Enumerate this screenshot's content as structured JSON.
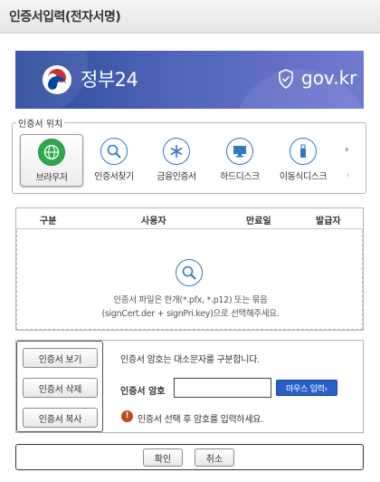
{
  "window": {
    "title": "인증서입력(전자서명)"
  },
  "banner": {
    "brand": "정부24",
    "domain": "gov.kr"
  },
  "location": {
    "legend": "인증서 위치",
    "items": [
      {
        "label": "브라우저",
        "icon": "globe-icon",
        "selected": true
      },
      {
        "label": "인증서찾기",
        "icon": "search-icon",
        "selected": false
      },
      {
        "label": "금융인증서",
        "icon": "asterisk-icon",
        "selected": false
      },
      {
        "label": "하드디스크",
        "icon": "monitor-icon",
        "selected": false
      },
      {
        "label": "이동식디스크",
        "icon": "usb-icon",
        "selected": false
      }
    ],
    "next": "›",
    "prev": "‹"
  },
  "table": {
    "columns": [
      "구분",
      "사용자",
      "만료일",
      "발급자"
    ],
    "empty_line1": "인증서 파일은 한개(*.pfx, *.p12) 또는 묶음",
    "empty_line2": "(signCert.der + signPri.key)으로 선택해주세요."
  },
  "actions": {
    "view": "인증서 보기",
    "delete": "인증서 삭제",
    "copy": "인증서 복사"
  },
  "password": {
    "notice": "인증서 암호는 대소문자를 구분합니다.",
    "label": "인증서 암호",
    "value": "",
    "mouse_input": "마우스 입력›",
    "warning_icon": "!",
    "warning": "인증서 선택 후 암호를 입력하세요."
  },
  "footer": {
    "ok": "확인",
    "cancel": "취소"
  },
  "colors": {
    "accent": "#2a5fc7",
    "banner": "#4a5fb5",
    "warning": "#c04a1a"
  }
}
